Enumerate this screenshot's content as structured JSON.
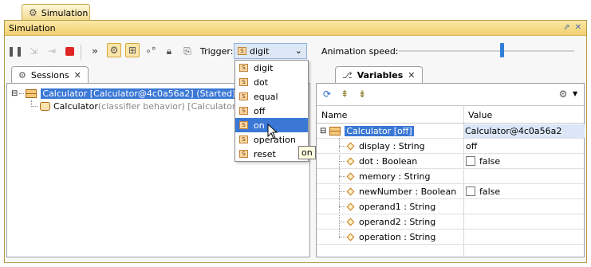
{
  "window_tab": {
    "label": "Simulation"
  },
  "titlebar": {
    "title": "Simulation",
    "ctrl_minimize": "⇗",
    "ctrl_close": "✕"
  },
  "toolbar": {
    "trigger_label": "Trigger:",
    "trigger_value": "digit",
    "animation_label": "Animation speed:",
    "animation_speed_fraction": 0.59
  },
  "trigger_dropdown": {
    "options": [
      "digit",
      "dot",
      "equal",
      "off",
      "on",
      "operation",
      "reset"
    ],
    "hovered": "on",
    "tooltip": "on"
  },
  "sessions_panel": {
    "tab_label": "Sessions",
    "root": {
      "label": "Calculator [Calculator@4c0a56a2] (Started)"
    },
    "child": {
      "name": "Calculator",
      "detail": "(classifier behavior) [Calculator@4c0a56a2]"
    }
  },
  "variables_panel": {
    "tab_label": "Variables",
    "columns": [
      "Name",
      "Value"
    ],
    "root_row": {
      "name": "Calculator [off]",
      "value": "Calculator@4c0a56a2"
    },
    "rows": [
      {
        "name": "display : String",
        "value": "off",
        "checkbox": false
      },
      {
        "name": "dot : Boolean",
        "value": "false",
        "checkbox": true
      },
      {
        "name": "memory : String",
        "value": "",
        "checkbox": false
      },
      {
        "name": "newNumber : Boolean",
        "value": "false",
        "checkbox": true
      },
      {
        "name": "operand1 : String",
        "value": "",
        "checkbox": false
      },
      {
        "name": "operand2 : String",
        "value": "",
        "checkbox": false
      },
      {
        "name": "operation : String",
        "value": "",
        "checkbox": false
      }
    ]
  }
}
